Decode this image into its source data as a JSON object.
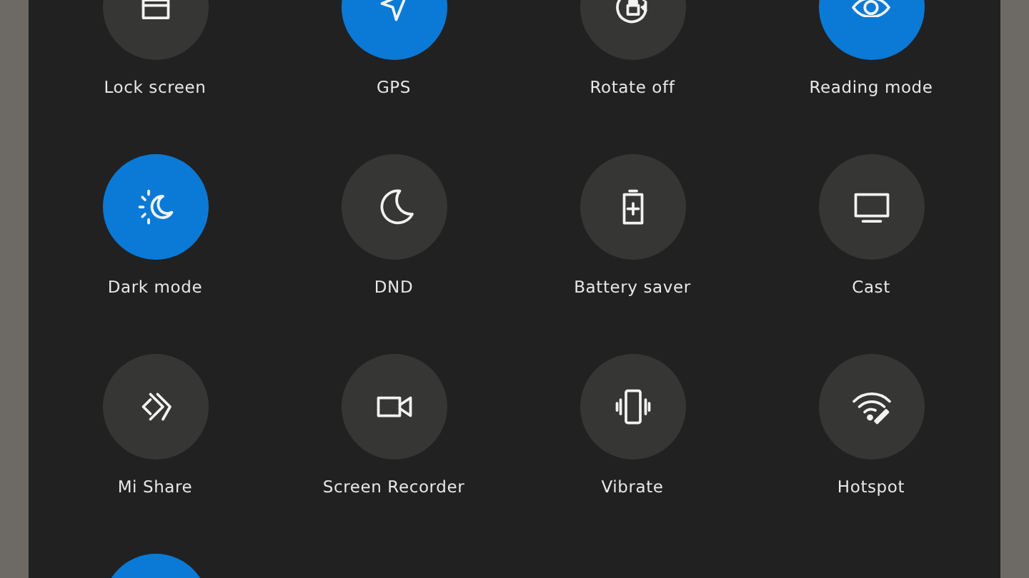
{
  "tiles": [
    {
      "label": "Lock screen",
      "on": false
    },
    {
      "label": "GPS",
      "on": true
    },
    {
      "label": "Rotate off",
      "on": false
    },
    {
      "label": "Reading mode",
      "on": true
    },
    {
      "label": "Dark mode",
      "on": true
    },
    {
      "label": "DND",
      "on": false
    },
    {
      "label": "Battery saver",
      "on": false
    },
    {
      "label": "Cast",
      "on": false
    },
    {
      "label": "Mi Share",
      "on": false
    },
    {
      "label": "Screen Recorder",
      "on": false
    },
    {
      "label": "Vibrate",
      "on": false
    },
    {
      "label": "Hotspot",
      "on": false
    },
    {
      "on": true
    }
  ]
}
